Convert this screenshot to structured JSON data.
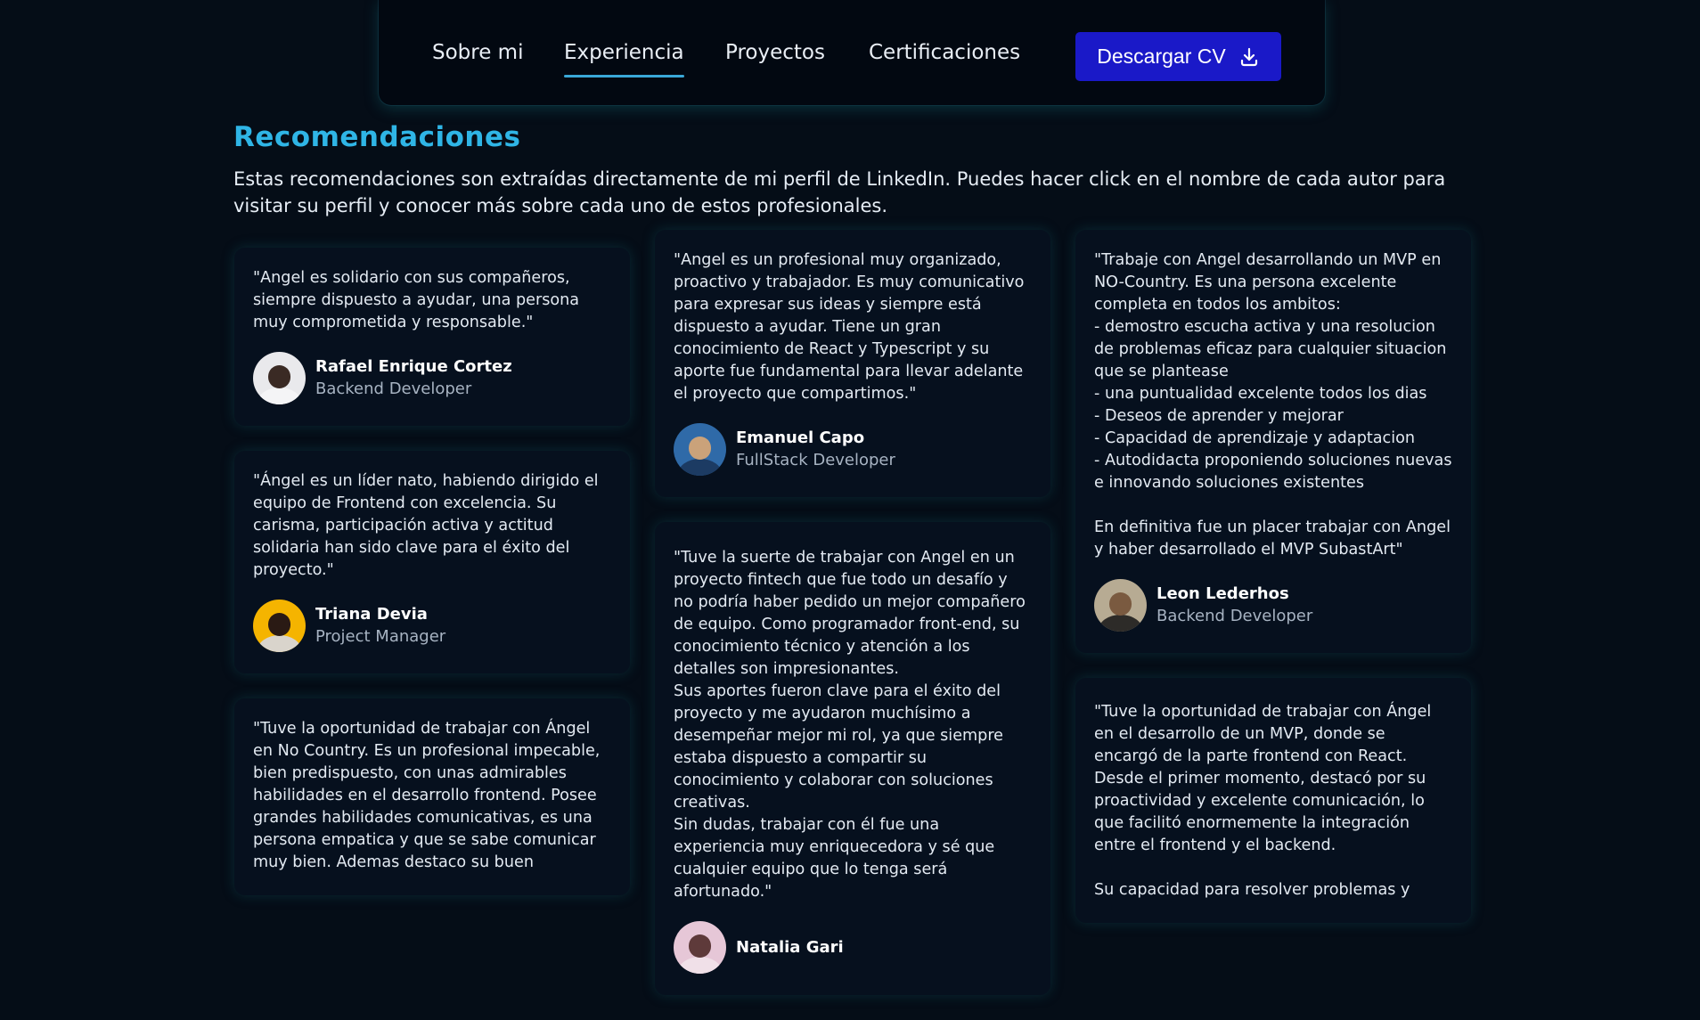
{
  "nav": {
    "links": [
      {
        "label": "Sobre mi"
      },
      {
        "label": "Experiencia",
        "active": true
      },
      {
        "label": "Proyectos"
      },
      {
        "label": "Certificaciones"
      }
    ],
    "download_label": "Descargar CV",
    "download_icon": "download-icon",
    "accent_color": "#1a19c8"
  },
  "section": {
    "title": "Recomendaciones",
    "description": "Estas recomendaciones son extraídas directamente de mi perfil de LinkedIn. Puedes hacer click en el nombre de cada autor para visitar su perfil y conocer más sobre cada uno de estos profesionales.",
    "title_color": "#2fb5e6"
  },
  "columns": [
    [
      {
        "quote": "\"Angel es solidario con sus compañeros, siempre dispuesto a ayudar, una persona muy comprometida y responsable.\"",
        "name": "Rafael Enrique Cortez",
        "role": "Backend Developer"
      },
      {
        "quote": "\"Ángel es un líder nato, habiendo dirigido el equipo de Frontend con excelencia. Su carisma, participación activa y actitud solidaria han sido clave para el éxito del proyecto.\"",
        "name": "Triana Devia",
        "role": "Project Manager"
      },
      {
        "quote": "\"Tuve la oportunidad de trabajar con Ángel en No Country. Es un profesional impecable, bien predispuesto, con unas admirables habilidades en el desarrollo frontend. Posee grandes habilidades comunicativas, es una persona empatica y que se sabe comunicar muy bien. Ademas destaco su buen"
      }
    ],
    [
      {
        "quote": "\"Angel es un profesional muy organizado, proactivo y trabajador. Es muy comunicativo para expresar sus ideas y siempre está dispuesto a ayudar. Tiene un gran conocimiento de React y Typescript y su aporte fue fundamental para llevar adelante el proyecto que compartimos.\"",
        "name": "Emanuel Capo",
        "role": "FullStack Developer"
      },
      {
        "quote": "\"Tuve la suerte de trabajar con Angel en un proyecto fintech que fue todo un desafío y no podría haber pedido un mejor compañero de equipo. Como programador front-end, su conocimiento técnico y atención a los detalles son impresionantes.\nSus aportes fueron clave para el éxito del proyecto y me ayudaron muchísimo a desempeñar mejor mi rol, ya que siempre estaba dispuesto a compartir su conocimiento y colaborar con soluciones creativas.\nSin dudas, trabajar con él fue una experiencia muy enriquecedora y sé que cualquier equipo que lo tenga será afortunado.\"",
        "name": "Natalia Gari"
      }
    ],
    [
      {
        "quote": "\"Trabaje con Angel desarrollando un MVP en NO-Country. Es una persona excelente completa en todos los ambitos:\n- demostro escucha activa y una resolucion de problemas eficaz para cualquier situacion que se plantease\n- una puntualidad excelente todos los dias\n- Deseos de aprender y mejorar\n- Capacidad de aprendizaje y adaptacion\n- Autodidacta proponiendo soluciones nuevas e innovando soluciones existentes\n\nEn definitiva fue un placer trabajar con Angel y haber desarrollado el MVP SubastArt\"",
        "name": "Leon Lederhos",
        "role": "Backend Developer"
      },
      {
        "quote": "\"Tuve la oportunidad de trabajar con Ángel en el desarrollo de un MVP, donde se encargó de la parte frontend con React. Desde el primer momento, destacó por su proactividad y excelente comunicación, lo que facilitó enormemente la integración entre el frontend y el backend.\n\nSu capacidad para resolver problemas y"
      }
    ]
  ],
  "avatar_colors": {
    "Rafael Enrique Cortez": [
      "#e9e9ec",
      "#3a2a24",
      "#f4f4f6"
    ],
    "Triana Devia": [
      "#f5b400",
      "#2a1a14",
      "#d9d4cc"
    ],
    "Emanuel Capo": [
      "#2f6aa8",
      "#caa27a",
      "#1c3b63"
    ],
    "Leon Lederhos": [
      "#b7ab93",
      "#7a5a40",
      "#2d2b28"
    ],
    "Natalia Gari": [
      "#e6c7d7",
      "#5e3a3a",
      "#f0e0e8"
    ]
  }
}
